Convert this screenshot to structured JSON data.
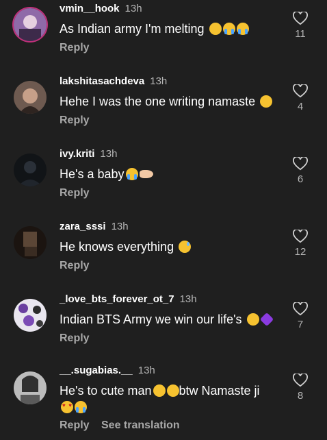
{
  "comments": [
    {
      "username": "vmin__hook",
      "time": "13h",
      "text": "As Indian army I'm melting",
      "emojis": [
        "melting-face",
        "loudly-crying-face",
        "loudly-crying-face"
      ],
      "reply": "Reply",
      "likes": "11"
    },
    {
      "username": "lakshitasachdeva",
      "time": "13h",
      "text": "Hehe I was the one writing namaste",
      "emojis": [
        "grinning-face"
      ],
      "reply": "Reply",
      "likes": "4"
    },
    {
      "username": "ivy.kriti",
      "time": "13h",
      "text": "He's a baby",
      "emojis": [
        "loudly-crying-face",
        "pointing-hand"
      ],
      "reply": "Reply",
      "likes": "6"
    },
    {
      "username": "zara_sssi",
      "time": "13h",
      "text": "He knows everything",
      "emojis": [
        "anxious-face"
      ],
      "reply": "Reply",
      "likes": "12"
    },
    {
      "username": "_love_bts_forever_ot_7",
      "time": "13h",
      "text": "Indian BTS Army we win our life's",
      "emojis": [
        "smiling-face",
        "purple-heart"
      ],
      "reply": "Reply",
      "likes": "7"
    },
    {
      "username": "__.sugabias.__",
      "time": "13h",
      "text": "He's to cute man",
      "text2": "btw Namaste ji",
      "emojis": [
        "grimacing-face",
        "face-blowing-kiss",
        "heart-eyes-face",
        "tears-of-joy-face"
      ],
      "reply": "Reply",
      "see_translation": "See translation",
      "likes": "8"
    }
  ],
  "colors": {
    "background": "#1f1f1f",
    "secondary_text": "#a8a8a8",
    "story_ring": "#c0307a"
  }
}
